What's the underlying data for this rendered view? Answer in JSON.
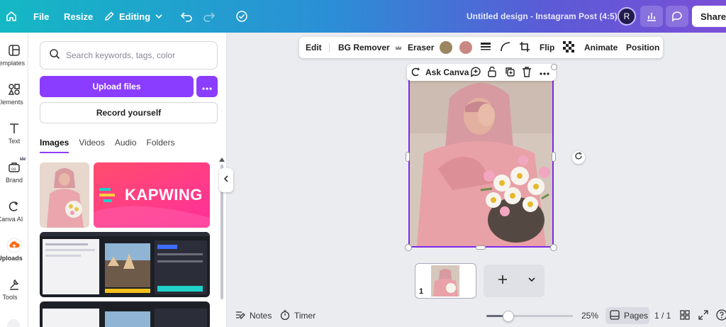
{
  "topbar": {
    "home_icon": "home-icon",
    "file_label": "File",
    "resize_label": "Resize",
    "editing_label": "Editing",
    "undo_icon": "undo-icon",
    "redo_icon": "redo-icon",
    "cloud_icon": "cloud-check-icon",
    "design_title": "Untitled design - Instagram Post (4:5)",
    "avatar_initial": "R",
    "share_label": "Share"
  },
  "rail": {
    "items": [
      {
        "label": "Templates",
        "icon": "templates-icon"
      },
      {
        "label": "Elements",
        "icon": "elements-icon"
      },
      {
        "label": "Text",
        "icon": "text-icon"
      },
      {
        "label": "Brand",
        "icon": "brand-icon"
      },
      {
        "label": "Canva AI",
        "icon": "canva-ai-icon"
      },
      {
        "label": "Uploads",
        "icon": "uploads-icon"
      },
      {
        "label": "Tools",
        "icon": "tools-icon"
      }
    ]
  },
  "panel": {
    "search_placeholder": "Search keywords, tags, color",
    "upload_label": "Upload files",
    "record_label": "Record yourself",
    "tabs": [
      "Images",
      "Videos",
      "Audio",
      "Folders"
    ],
    "active_tab": "Images",
    "kapwing_text": "KAPWING"
  },
  "toolbar": {
    "edit": "Edit",
    "bg_remover": "BG Remover",
    "eraser": "Eraser",
    "flip": "Flip",
    "animate": "Animate",
    "position": "Position",
    "swatch_1": "#9c8561",
    "swatch_2": "#c98883"
  },
  "mini_toolbar": {
    "ask_canva": "Ask Canva"
  },
  "pages": {
    "thumb_number": "1"
  },
  "bottombar": {
    "notes": "Notes",
    "timer": "Timer",
    "zoom": "25%",
    "zoom_level": 0.25,
    "pages": "Pages",
    "page_count": "1 / 1"
  },
  "colors": {
    "accent": "#8b3dff",
    "selection": "#7d2ae8"
  }
}
